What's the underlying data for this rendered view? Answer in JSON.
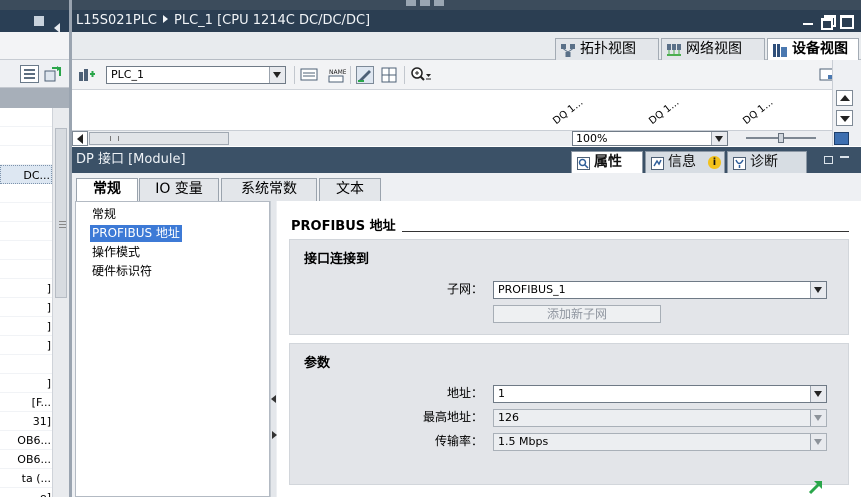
{
  "window": {
    "project": "L15S021PLC",
    "device": "PLC_1 [CPU 1214C DC/DC/DC]"
  },
  "project_tree": {
    "rows": [
      "DC...",
      "",
      "",
      "",
      "",
      "",
      "",
      "",
      "",
      "]",
      "]",
      "]",
      "]",
      "",
      "]",
      "[F...",
      "31]",
      "OB6...",
      "OB6...",
      "ta (...",
      "o]"
    ]
  },
  "view_tabs": [
    {
      "label": "拓扑视图",
      "icon": "topology-icon"
    },
    {
      "label": "网络视图",
      "icon": "network-icon"
    },
    {
      "label": "设备视图",
      "icon": "device-icon"
    }
  ],
  "device_toolbar": {
    "device_select": "PLC_1"
  },
  "canvas": {
    "dq_labels": [
      "DQ 1...",
      "DQ 1...",
      "DQ 1..."
    ],
    "zoom": "100%"
  },
  "inspector": {
    "title": "DP 接口 [Module]",
    "tabs": [
      {
        "label": "属性",
        "icon": "properties-icon"
      },
      {
        "label": "信息",
        "icon": "info-icon"
      },
      {
        "label": "诊断",
        "icon": "diagnostics-icon"
      }
    ],
    "sub_tabs": [
      "常规",
      "IO 变量",
      "系统常数",
      "文本"
    ],
    "nav_items": [
      "常规",
      "PROFIBUS 地址",
      "操作模式",
      "硬件标识符"
    ],
    "section_title": "PROFIBUS 地址",
    "group1": {
      "title": "接口连接到",
      "subnet_label": "子网：",
      "subnet_value": "PROFIBUS_1",
      "add_button": "添加新子网"
    },
    "group2": {
      "title": "参数",
      "address_label": "地址：",
      "address_value": "1",
      "highest_label": "最高地址：",
      "highest_value": "126",
      "rate_label": "传输率：",
      "rate_value": "1.5 Mbps"
    }
  },
  "colors": {
    "title_bar": "#2b3e52",
    "inspector_header": "#3b5167",
    "selection": "#3d7ad6",
    "accent_green": "#2aa64a"
  }
}
